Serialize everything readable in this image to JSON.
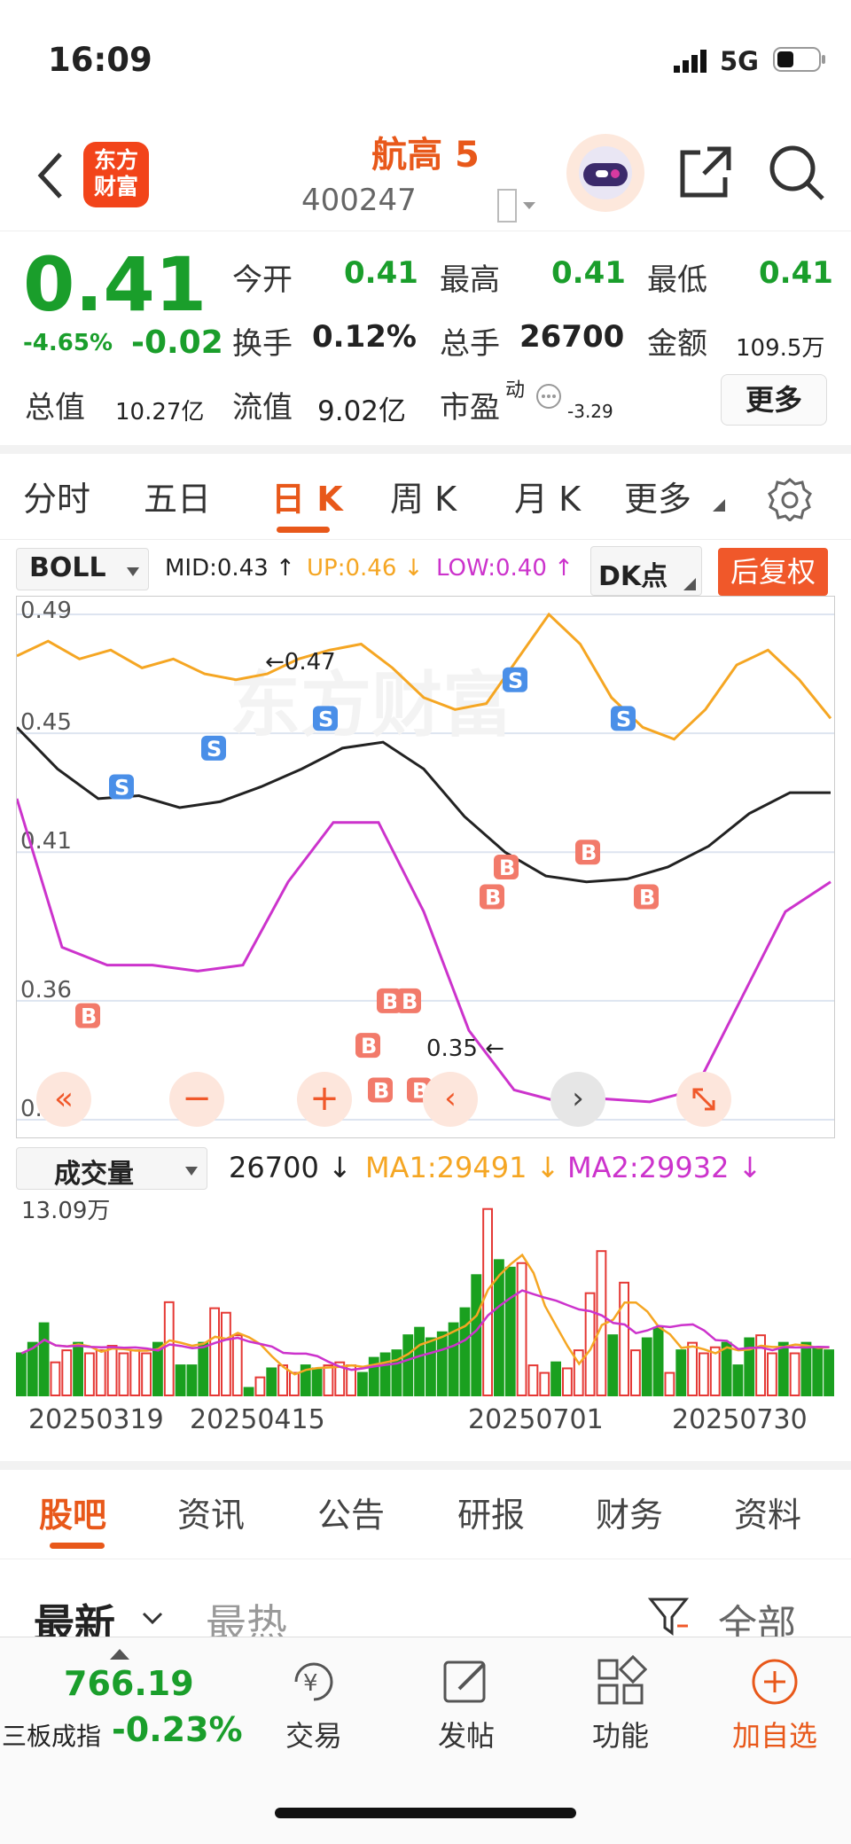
{
  "status": {
    "time": "16:09",
    "network": "5G"
  },
  "nav": {
    "logo_text_1": "东方",
    "logo_text_2": "财富",
    "stock_name": "航高 5",
    "stock_code": "400247"
  },
  "quote": {
    "price": "0.41",
    "change_pct": "-4.65%",
    "change": "-0.02",
    "open_label": "今开",
    "open": "0.41",
    "high_label": "最高",
    "high": "0.41",
    "low_label": "最低",
    "low": "0.41",
    "turnover_label": "换手",
    "turnover": "0.12%",
    "volume_label": "总手",
    "volume": "26700",
    "amount_label": "金额",
    "amount": "109.5万",
    "mcap_label": "总值",
    "mcap": "10.27亿",
    "float_label": "流值",
    "float": "9.02亿",
    "pe_label": "市盈",
    "pe_sup": "动",
    "pe": "-3.29",
    "more_label": "更多"
  },
  "tabs": [
    "分时",
    "五日",
    "日 K",
    "周 K",
    "月 K",
    "更多"
  ],
  "active_tab": "日 K",
  "indicator": {
    "name": "BOLL",
    "mid": "MID:0.43",
    "up": "UP:0.46",
    "low": "LOW:0.40",
    "dk": "DK点",
    "adjust": "后复权",
    "colors": {
      "mid": "#222222",
      "up": "#f5a623",
      "low": "#cc33cc"
    }
  },
  "chart_data": {
    "type": "line",
    "yticks": [
      "0.49",
      "0.45",
      "0.41",
      "0.36",
      "0.32"
    ],
    "ylim": [
      0.32,
      0.49
    ],
    "annotations": [
      "←0.47",
      "0.35 ←"
    ],
    "markers": {
      "buy": "B",
      "sell": "S"
    },
    "series": [
      {
        "name": "UP",
        "values": [
          0.476,
          0.481,
          0.475,
          0.478,
          0.472,
          0.475,
          0.47,
          0.468,
          0.47,
          0.475,
          0.478,
          0.48,
          0.472,
          0.462,
          0.458,
          0.46,
          0.475,
          0.49,
          0.48,
          0.462,
          0.452,
          0.448,
          0.458,
          0.473,
          0.478,
          0.468,
          0.455
        ]
      },
      {
        "name": "MID",
        "values": [
          0.452,
          0.438,
          0.428,
          0.429,
          0.425,
          0.427,
          0.432,
          0.438,
          0.445,
          0.447,
          0.438,
          0.422,
          0.41,
          0.402,
          0.4,
          0.401,
          0.405,
          0.412,
          0.423,
          0.43,
          0.43
        ]
      },
      {
        "name": "LOW",
        "values": [
          0.428,
          0.378,
          0.372,
          0.372,
          0.37,
          0.372,
          0.4,
          0.42,
          0.42,
          0.39,
          0.35,
          0.33,
          0.326,
          0.327,
          0.326,
          0.33,
          0.36,
          0.39,
          0.4
        ]
      }
    ]
  },
  "volume": {
    "label": "成交量",
    "value": "26700",
    "ma1": "MA1:29491",
    "ma2": "MA2:29932",
    "max_label": "13.09万",
    "ymax": 130900,
    "bars": [
      28000,
      35000,
      48000,
      22000,
      30000,
      35000,
      28000,
      30000,
      33000,
      28000,
      30000,
      28000,
      35000,
      62000,
      20000,
      20000,
      35000,
      58000,
      55000,
      40000,
      5000,
      12000,
      18000,
      20000,
      15000,
      20000,
      18000,
      20000,
      22000,
      20000,
      15000,
      25000,
      28000,
      30000,
      40000,
      45000,
      38000,
      42000,
      48000,
      58000,
      80000,
      124000,
      90000,
      85000,
      88000,
      20000,
      15000,
      22000,
      18000,
      30000,
      68000,
      96000,
      40000,
      75000,
      30000,
      38000,
      45000,
      15000,
      30000,
      35000,
      28000,
      32000,
      35000,
      20000,
      38000,
      40000,
      28000,
      35000,
      28000,
      35000,
      32000,
      30000
    ],
    "bar_colors": [
      "g",
      "g",
      "g",
      "r",
      "r",
      "g",
      "r",
      "r",
      "r",
      "r",
      "r",
      "r",
      "g",
      "r",
      "g",
      "g",
      "g",
      "r",
      "r",
      "r",
      "g",
      "r",
      "g",
      "r",
      "r",
      "g",
      "g",
      "r",
      "r",
      "r",
      "g",
      "g",
      "g",
      "g",
      "g",
      "g",
      "g",
      "g",
      "g",
      "g",
      "g",
      "r",
      "g",
      "g",
      "r",
      "r",
      "r",
      "g",
      "r",
      "r",
      "r",
      "r",
      "g",
      "r",
      "r",
      "g",
      "g",
      "r",
      "g",
      "r",
      "r",
      "r",
      "g",
      "g",
      "g",
      "r",
      "r",
      "g",
      "r",
      "g",
      "g",
      "g"
    ]
  },
  "dates": [
    "20250319",
    "20250415",
    "20250701",
    "20250730"
  ],
  "guba_tabs": [
    "股吧",
    "资讯",
    "公告",
    "研报",
    "财务",
    "资料"
  ],
  "filter": {
    "latest": "最新",
    "hot": "最热",
    "all": "全部"
  },
  "bottom": {
    "index_value": "766.19",
    "index_name": "三板成指",
    "index_change": "-0.23%",
    "trade": "交易",
    "post": "发帖",
    "function": "功能",
    "add": "加自选"
  }
}
